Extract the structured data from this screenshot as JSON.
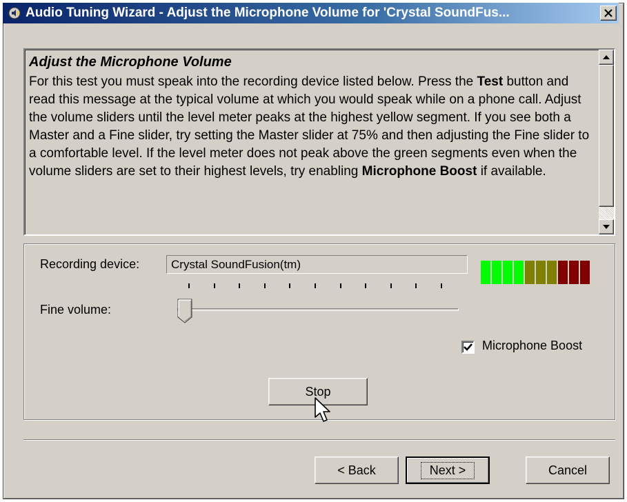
{
  "window": {
    "title": "Audio Tuning Wizard - Adjust the Microphone Volume for 'Crystal SoundFus...",
    "close_label": "✕"
  },
  "info": {
    "heading": "Adjust the Microphone Volume",
    "p1": "For this test you must speak into the recording device listed below. Press the ",
    "test_word": "Test",
    "p2": " button and read this message at the typical volume at which you would speak while on a phone call. Adjust the volume sliders until the level meter peaks at the highest yellow segment. If you see both a Master and a Fine slider, try setting the Master slider at 75% and then adjusting the Fine slider to a comfortable level. If the level meter does not peak above the green segments even when the volume sliders are set to their highest levels, try enabling ",
    "boost_word": "Microphone Boost",
    "p3": " if available."
  },
  "controls": {
    "recording_device_label": "Recording device:",
    "recording_device_value": "Crystal SoundFusion(tm)",
    "fine_volume_label": "Fine volume:",
    "fine_volume_value": 0.0,
    "slider_tick_count": 11,
    "level_meter": {
      "segments": 10,
      "lit": 10,
      "colors": [
        "#00ff00",
        "#00ff00",
        "#00ff00",
        "#00ff00",
        "#808000",
        "#808000",
        "#808000",
        "#800000",
        "#800000",
        "#800000"
      ]
    },
    "microphone_boost_label": "Microphone Boost",
    "microphone_boost_checked": true,
    "stop_label": "Stop"
  },
  "footer": {
    "back_label": "< Back",
    "next_label": "Next >",
    "cancel_label": "Cancel"
  },
  "icons": {
    "app": "audio-wizard-icon",
    "scroll_up": "scroll-up-arrow-icon",
    "scroll_down": "scroll-down-arrow-icon",
    "cursor": "mouse-pointer-icon"
  }
}
